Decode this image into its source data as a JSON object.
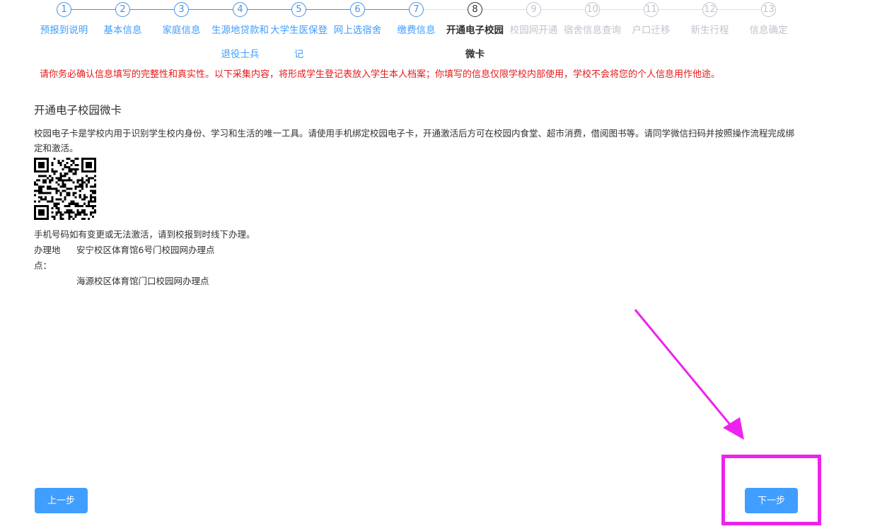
{
  "steps": [
    {
      "num": "1",
      "label": "预报到说明",
      "state": "done"
    },
    {
      "num": "2",
      "label": "基本信息",
      "state": "done"
    },
    {
      "num": "3",
      "label": "家庭信息",
      "state": "done"
    },
    {
      "num": "4",
      "label": "生源地贷款和退役士兵",
      "state": "done"
    },
    {
      "num": "5",
      "label": "大学生医保登记",
      "state": "done"
    },
    {
      "num": "6",
      "label": "网上选宿舍",
      "state": "done"
    },
    {
      "num": "7",
      "label": "缴费信息",
      "state": "done"
    },
    {
      "num": "8",
      "label": "开通电子校园微卡",
      "state": "current"
    },
    {
      "num": "9",
      "label": "校园网开通",
      "state": "future"
    },
    {
      "num": "10",
      "label": "宿舍信息查询",
      "state": "future"
    },
    {
      "num": "11",
      "label": "户口迁移",
      "state": "future"
    },
    {
      "num": "12",
      "label": "新生行程",
      "state": "future"
    },
    {
      "num": "13",
      "label": "信息确定",
      "state": "future"
    }
  ],
  "warning": "请你务必确认信息填写的完整性和真实性。以下采集内容，将形成学生登记表放入学生本人档案；你填写的信息仅限学校内部使用，学校不会将您的个人信息用作他途。",
  "section": {
    "title": "开通电子校园微卡",
    "description": "校园电子卡是学校内用于识别学生校内身份、学习和生活的唯一工具。请使用手机绑定校园电子卡，开通激活后方可在校园内食堂、超市消费，借阅图书等。请同学微信扫码并按照操作流程完成绑定和激活。",
    "note": "手机号码如有变更或无法激活，请到校报到时线下办理。",
    "location_label": "办理地点：",
    "locations": [
      "安宁校区体育馆6号门校园网办理点",
      "海源校区体育馆门口校园网办理点"
    ]
  },
  "buttons": {
    "prev": "上一步",
    "next": "下一步"
  },
  "colors": {
    "primary": "#409eff",
    "warning": "#e61a1a",
    "highlight": "#ee22ee"
  }
}
